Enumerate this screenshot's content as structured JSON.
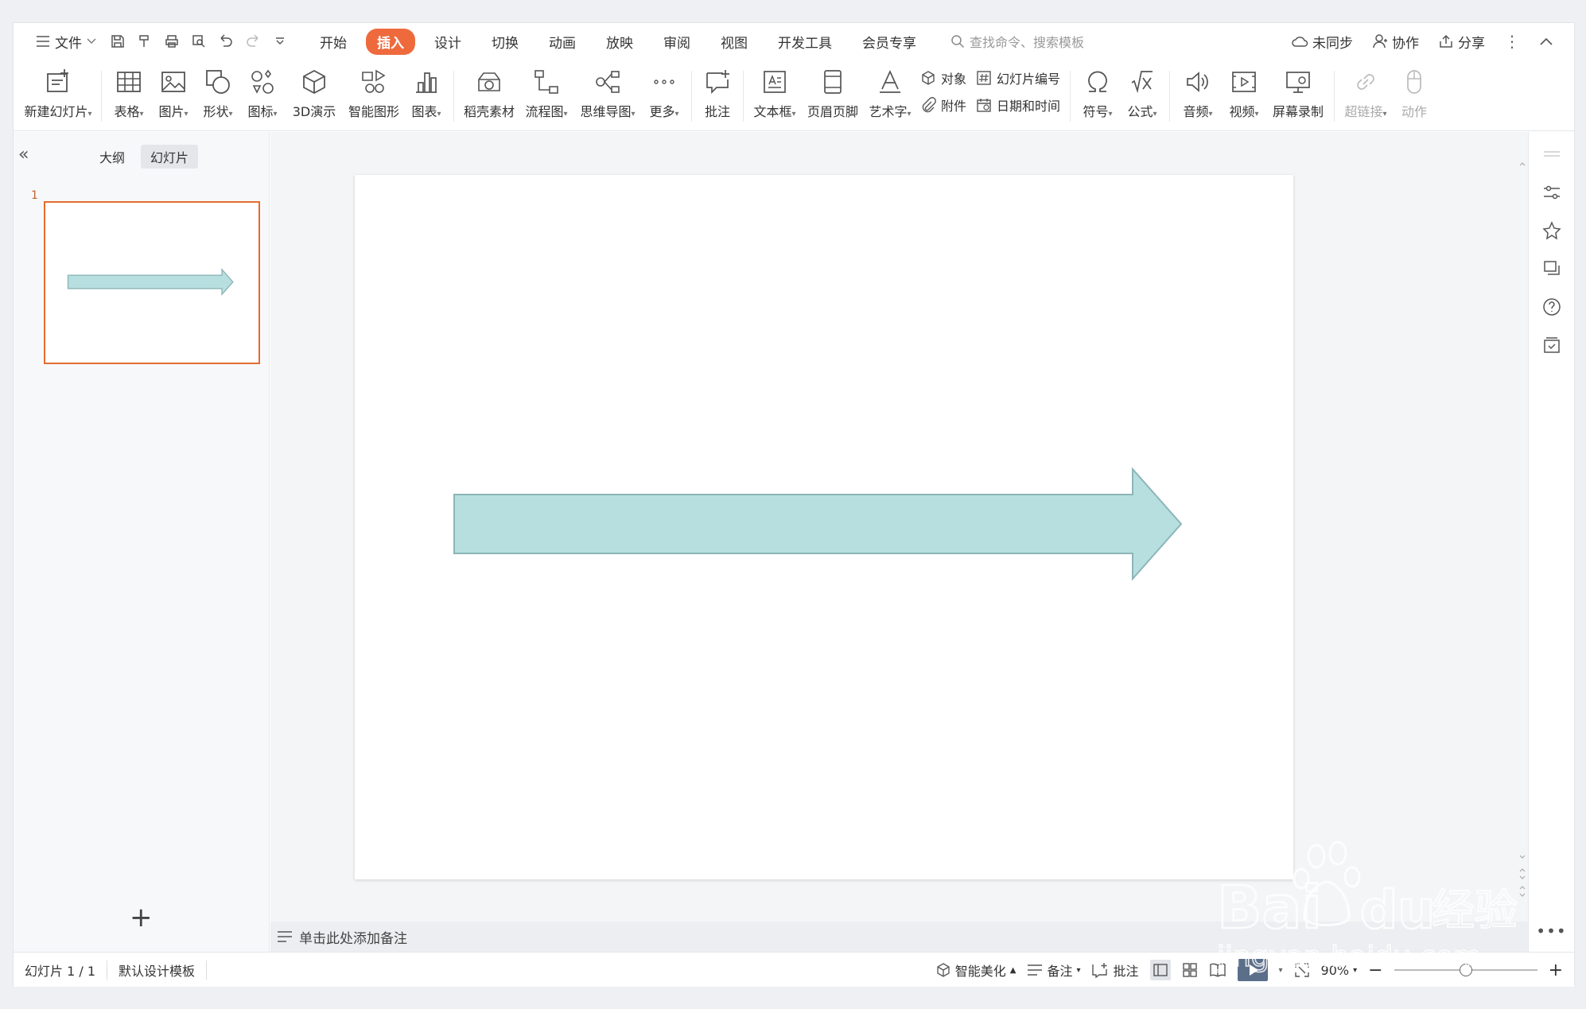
{
  "menubar": {
    "file_label": "文件",
    "tabs": [
      {
        "label": "开始",
        "active": false
      },
      {
        "label": "插入",
        "active": true
      },
      {
        "label": "设计",
        "active": false
      },
      {
        "label": "切换",
        "active": false
      },
      {
        "label": "动画",
        "active": false
      },
      {
        "label": "放映",
        "active": false
      },
      {
        "label": "审阅",
        "active": false
      },
      {
        "label": "视图",
        "active": false
      },
      {
        "label": "开发工具",
        "active": false
      },
      {
        "label": "会员专享",
        "active": false
      }
    ],
    "search_placeholder": "查找命令、搜索模板",
    "sync_label": "未同步",
    "collab_label": "协作",
    "share_label": "分享"
  },
  "ribbon": {
    "new_slide": "新建幻灯片",
    "table": "表格",
    "picture": "图片",
    "shape": "形状",
    "icon": "图标",
    "demo3d": "3D演示",
    "smartart": "智能图形",
    "chart": "图表",
    "material": "稻壳素材",
    "flowchart": "流程图",
    "mindmap": "思维导图",
    "more": "更多",
    "comment": "批注",
    "textbox": "文本框",
    "header_footer": "页眉页脚",
    "wordart": "艺术字",
    "object": "对象",
    "slide_number": "幻灯片编号",
    "attachment": "附件",
    "datetime": "日期和时间",
    "symbol": "符号",
    "formula": "公式",
    "audio": "音频",
    "video": "视频",
    "screen_record": "屏幕录制",
    "hyperlink": "超链接",
    "action": "动作"
  },
  "panel": {
    "tab_outline": "大纲",
    "tab_slides": "幻灯片",
    "slide_number": "1",
    "add_icon": "+"
  },
  "shape_colors": {
    "fill": "#b7dfe0",
    "stroke": "#8cb5b7"
  },
  "accent_color": "#ee6a3d",
  "notes_placeholder": "单击此处添加备注",
  "status": {
    "slide_count": "幻灯片 1 / 1",
    "template": "默认设计模板",
    "beautify": "智能美化",
    "notes": "备注",
    "comments": "批注",
    "zoom": "90%",
    "zoom_level": 0.5
  },
  "watermark": {
    "brand": "Baidu经验",
    "url": "jingyan.baidu.com"
  }
}
